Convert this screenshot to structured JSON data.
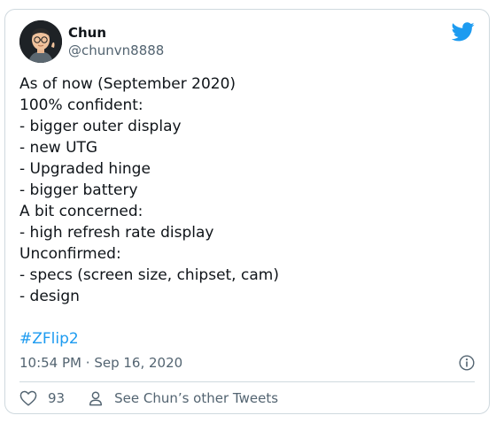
{
  "tweet": {
    "author": {
      "name": "Chun",
      "handle": "@chunvn8888",
      "avatar_icon": "avatar-memoji"
    },
    "brand_icon": "twitter-bird-icon",
    "brand_color": "#1d9bf0",
    "lines": [
      "As of now (September 2020)",
      "100% confident:",
      "- bigger outer display",
      "- new UTG",
      "- Upgraded hinge",
      "- bigger battery",
      "A bit concerned:",
      "- high refresh rate display",
      "Unconfirmed:",
      "- specs (screen size, chipset, cam)",
      "- design"
    ],
    "hashtag": "#ZFlip2",
    "time": "10:54 PM",
    "separator": "·",
    "date": "Sep 16, 2020",
    "likes": "93",
    "other_tweets_label": "See Chun’s other Tweets"
  }
}
